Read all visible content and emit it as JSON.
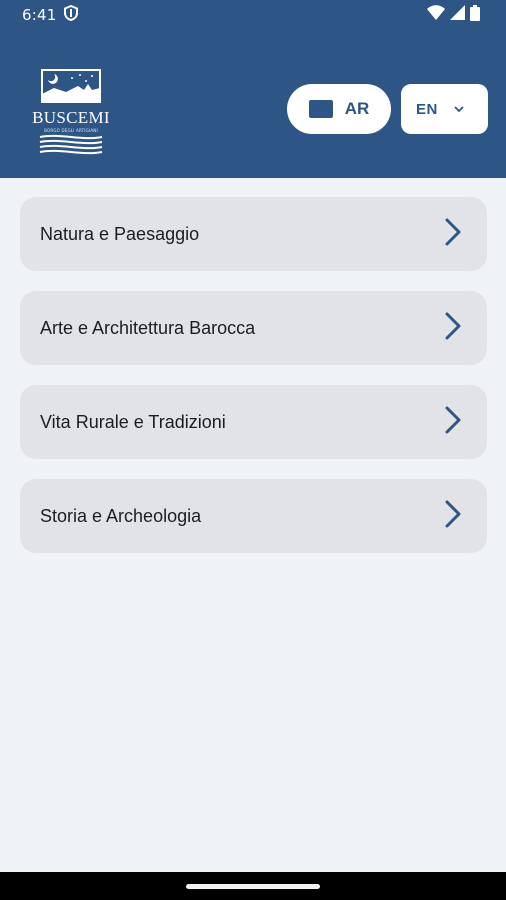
{
  "status_bar": {
    "time": "6:41",
    "icons": [
      "shield-icon",
      "wifi-icon",
      "signal-icon",
      "battery-icon"
    ]
  },
  "header": {
    "logo": {
      "name": "BUSCEMI",
      "subtitle": "BORGO DEGLI ARTIGIANI"
    },
    "ar_button": {
      "label": "AR",
      "icon": "ar-icon"
    },
    "language_select": {
      "value": "EN",
      "icon": "chevron-down-icon"
    }
  },
  "categories": [
    {
      "label": "Natura e Paesaggio",
      "icon": "chevron-right-icon"
    },
    {
      "label": "Arte e Architettura Barocca",
      "icon": "chevron-right-icon"
    },
    {
      "label": "Vita Rurale e Tradizioni",
      "icon": "chevron-right-icon"
    },
    {
      "label": "Storia e Archeologia",
      "icon": "chevron-right-icon"
    }
  ],
  "colors": {
    "primary": "#2d5687",
    "background": "#eff3f6",
    "card": "#e2e3e7",
    "text": "#1b1d22"
  }
}
